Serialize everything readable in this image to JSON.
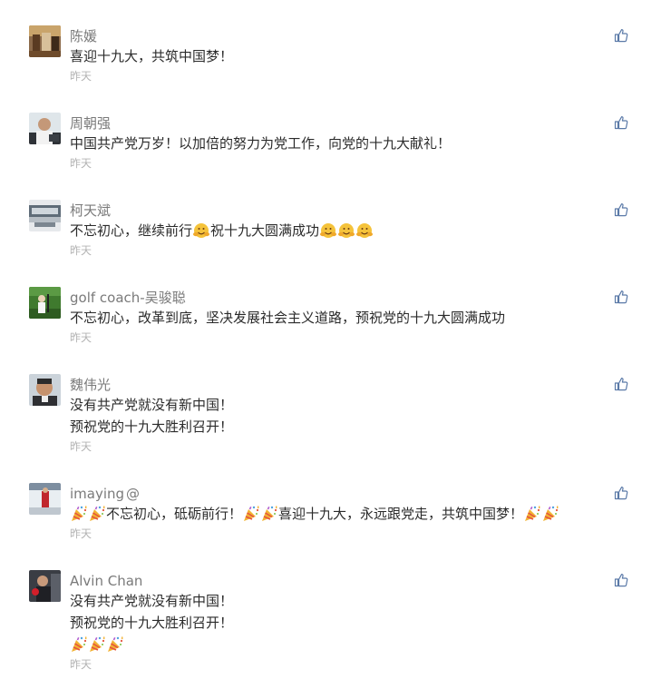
{
  "comments": [
    {
      "name": "陈媛",
      "lines": [
        [
          {
            "t": "text",
            "v": "喜迎十九大，共筑中国梦！"
          }
        ]
      ],
      "time": "昨天",
      "avatar": "avatar-1"
    },
    {
      "name": "周朝强",
      "lines": [
        [
          {
            "t": "text",
            "v": "中国共产党万岁！以加倍的努力为党工作，向党的十九大献礼！"
          }
        ]
      ],
      "time": "昨天",
      "avatar": "avatar-2"
    },
    {
      "name": "柯天斌",
      "lines": [
        [
          {
            "t": "text",
            "v": "不忘初心，继续前行"
          },
          {
            "t": "emoji",
            "v": "clapping-emoji"
          },
          {
            "t": "text",
            "v": "祝十九大圆满成功"
          },
          {
            "t": "emoji",
            "v": "clapping-emoji"
          },
          {
            "t": "emoji",
            "v": "clapping-emoji"
          },
          {
            "t": "emoji",
            "v": "clapping-emoji"
          }
        ]
      ],
      "time": "昨天",
      "avatar": "avatar-3"
    },
    {
      "name": "golf coach-吴骏聪",
      "lines": [
        [
          {
            "t": "text",
            "v": "不忘初心，改革到底，坚决发展社会主义道路，预祝党的十九大圆满成功"
          }
        ]
      ],
      "time": "昨天",
      "avatar": "avatar-4"
    },
    {
      "name": "魏伟光",
      "lines": [
        [
          {
            "t": "text",
            "v": "没有共产党就没有新中国！"
          }
        ],
        [
          {
            "t": "text",
            "v": "预祝党的十九大胜利召开！"
          }
        ]
      ],
      "time": "昨天",
      "avatar": "avatar-5"
    },
    {
      "name": "imaying",
      "name_suffix": "@",
      "lines": [
        [
          {
            "t": "emoji",
            "v": "party-popper-emoji"
          },
          {
            "t": "emoji",
            "v": "party-popper-emoji"
          },
          {
            "t": "text",
            "v": "不忘初心，砥砺前行！"
          },
          {
            "t": "emoji",
            "v": "party-popper-emoji"
          },
          {
            "t": "emoji",
            "v": "party-popper-emoji"
          },
          {
            "t": "text",
            "v": "喜迎十九大，永远跟党走，共筑中国梦！"
          },
          {
            "t": "emoji",
            "v": "party-popper-emoji"
          },
          {
            "t": "emoji",
            "v": "party-popper-emoji"
          }
        ]
      ],
      "time": "昨天",
      "avatar": "avatar-6"
    },
    {
      "name": "Alvin Chan",
      "lines": [
        [
          {
            "t": "text",
            "v": "没有共产党就没有新中国！"
          }
        ],
        [
          {
            "t": "text",
            "v": "预祝党的十九大胜利召开！"
          }
        ],
        [
          {
            "t": "emoji",
            "v": "party-popper-emoji"
          },
          {
            "t": "emoji",
            "v": "party-popper-emoji"
          },
          {
            "t": "emoji",
            "v": "party-popper-emoji"
          }
        ]
      ],
      "time": "昨天",
      "avatar": "avatar-7"
    }
  ],
  "like_icon": "thumbs-up-icon",
  "colors": {
    "name": "#7a7a7a",
    "text": "#2b2b2b",
    "time": "#b3b3b3",
    "like": "#5b7aa8"
  }
}
